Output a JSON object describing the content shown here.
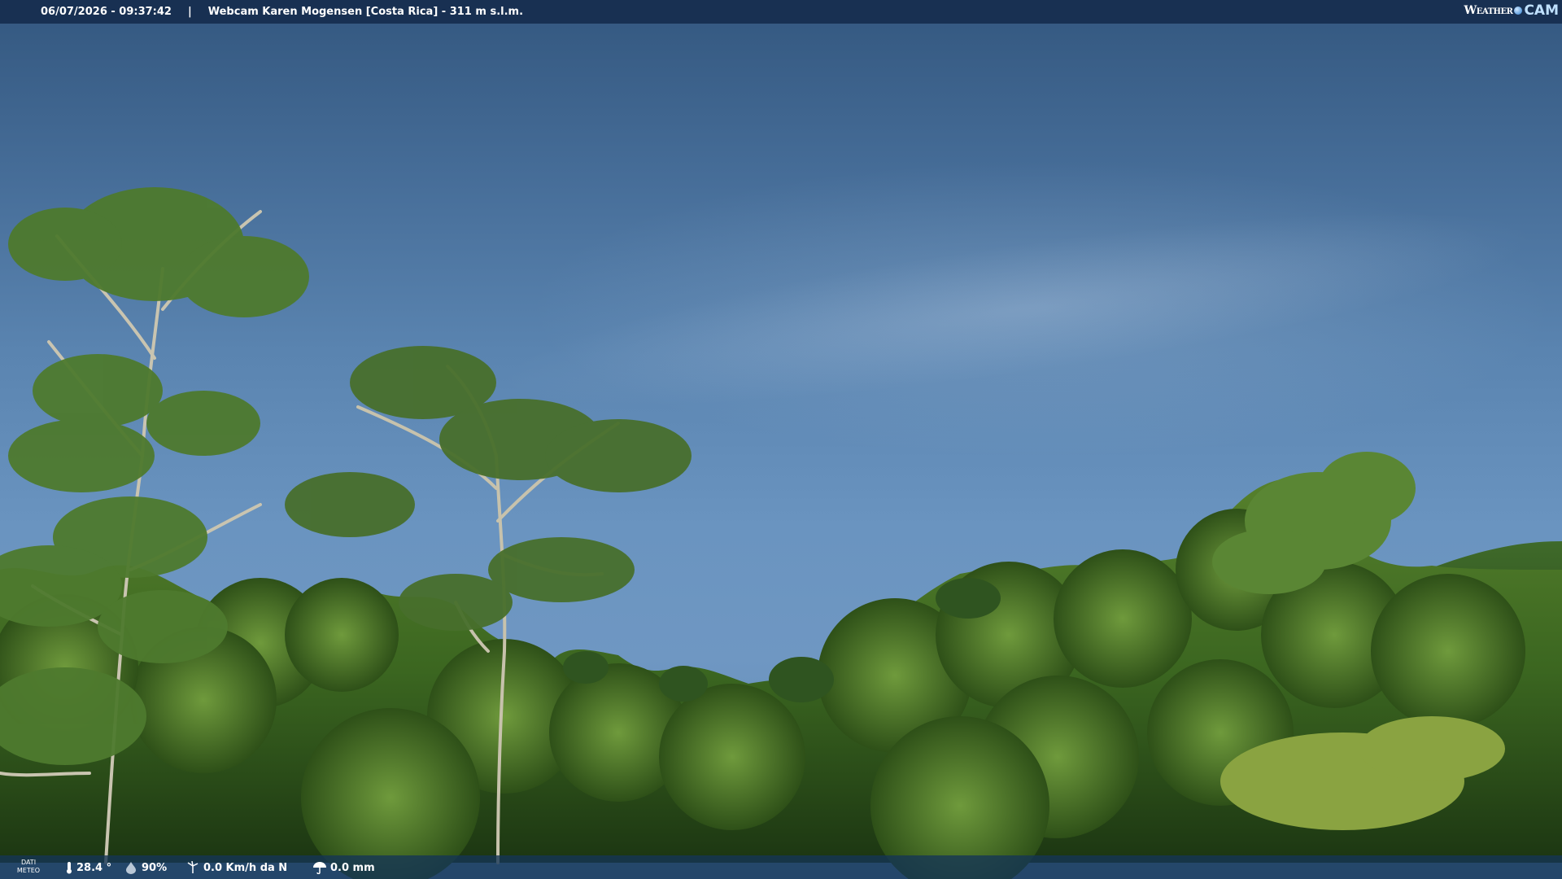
{
  "header": {
    "timestamp": "06/07/2026 - 09:37:42",
    "separator": "|",
    "title": "Webcam Karen Mogensen [Costa Rica]  - 311 m s.l.m."
  },
  "logo": {
    "word": "Weather",
    "cam": "CAM"
  },
  "weather": {
    "label_line1": "DATI",
    "label_line2": "METEO",
    "temperature": "28.4 °",
    "humidity": "90%",
    "wind": "0.0 Km/h da N",
    "rain": "0.0 mm"
  },
  "icons": {
    "thermometer": "thermometer-icon",
    "humidity": "humidity-drop-icon",
    "wind": "wind-icon",
    "rain": "umbrella-icon"
  },
  "colors": {
    "bar": "#162c4e",
    "sky_top": "#33577f",
    "sky_mid": "#6a94c0",
    "foliage_dark": "#1f3a14",
    "foliage_mid": "#3f6a22",
    "foliage_light": "#7d9a3a"
  }
}
